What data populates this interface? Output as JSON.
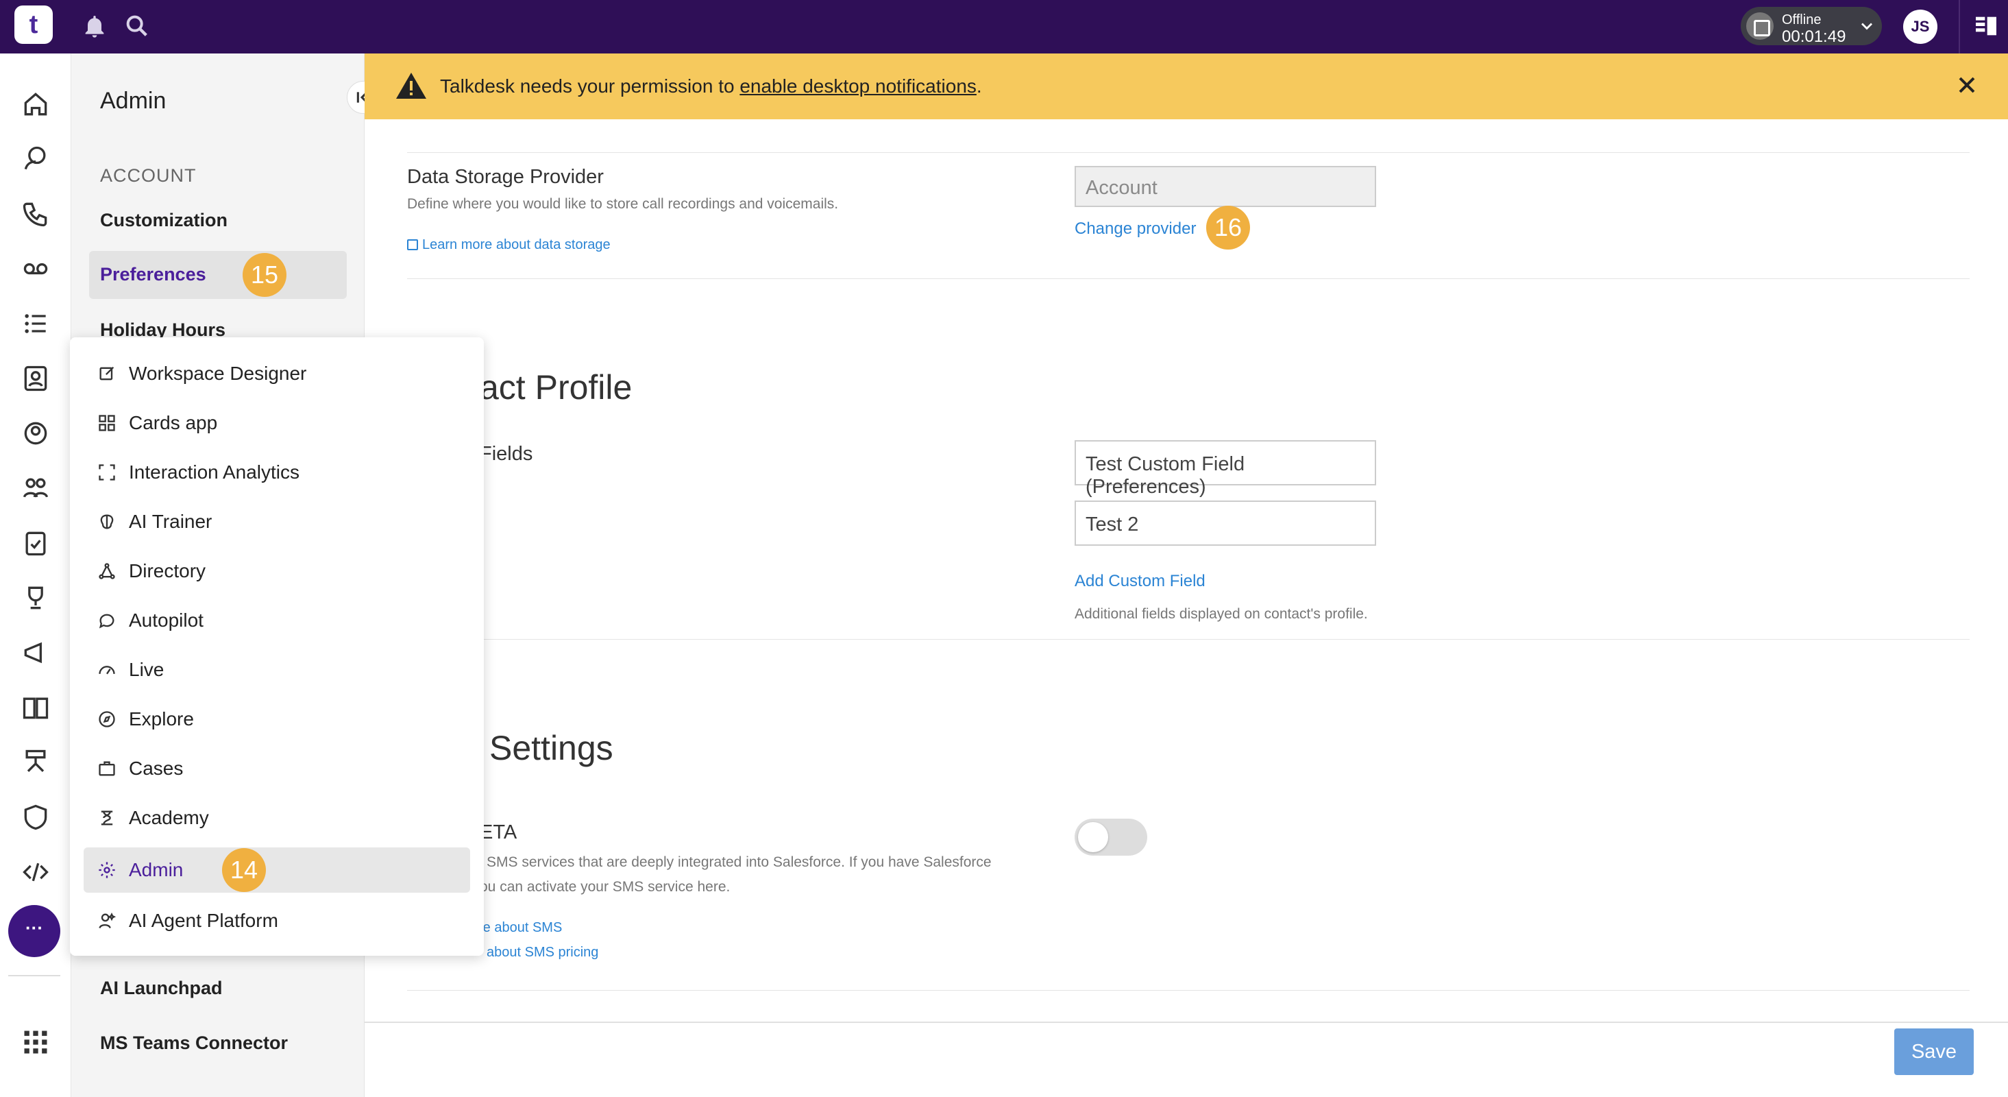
{
  "topbar": {
    "logo_text": "t",
    "status_label": "Offline",
    "status_time": "00:01:49",
    "avatar_initials": "JS"
  },
  "panel": {
    "title": "Admin",
    "section": "ACCOUNT",
    "items": [
      "Customization",
      "Preferences",
      "Holiday Hours"
    ],
    "below_items": [
      "AI Launchpad",
      "MS Teams Connector"
    ]
  },
  "banner": {
    "text_before": "Talkdesk needs your permission to ",
    "link": "enable desktop notifications",
    "text_after": "."
  },
  "data_storage": {
    "label": "Data Storage Provider",
    "description": "Define where you would like to store call recordings and voicemails.",
    "learn_more": "Learn more about data storage",
    "input_value": "Account",
    "change_provider": "Change provider"
  },
  "contact_profile": {
    "title": "act Profile",
    "fields_label": "Fields",
    "field1": "Test Custom Field (Preferences)",
    "field2": "Test 2",
    "add_field": "Add Custom Field",
    "hint": "Additional fields displayed on contact's profile."
  },
  "sms": {
    "title": "Settings",
    "label": "ETA",
    "desc1": "SMS services that are deeply integrated into Salesforce. If you have Salesforce",
    "desc2": "ou can activate your SMS service here.",
    "link1": "re about SMS",
    "link2": "about SMS pricing"
  },
  "footer": {
    "save": "Save"
  },
  "menu": {
    "items": [
      {
        "label": "Workspace Designer",
        "icon": "edit-square-icon"
      },
      {
        "label": "Cards app",
        "icon": "grid-icon"
      },
      {
        "label": "Interaction Analytics",
        "icon": "scan-icon"
      },
      {
        "label": "AI Trainer",
        "icon": "brain-icon"
      },
      {
        "label": "Directory",
        "icon": "network-icon"
      },
      {
        "label": "Autopilot",
        "icon": "chat-bot-icon"
      },
      {
        "label": "Live",
        "icon": "gauge-icon"
      },
      {
        "label": "Explore",
        "icon": "compass-icon"
      },
      {
        "label": "Cases",
        "icon": "briefcase-icon"
      },
      {
        "label": "Academy",
        "icon": "academy-icon"
      },
      {
        "label": "Admin",
        "icon": "gear-icon"
      },
      {
        "label": "AI Agent Platform",
        "icon": "agent-icon"
      }
    ]
  },
  "badges": {
    "preferences": "15",
    "admin": "14",
    "change_provider": "16"
  },
  "colors": {
    "topbar": "#2f0f57",
    "banner": "#f6c95d",
    "accent": "#4b1f9b",
    "link": "#2b84d4",
    "badge": "#f0b040"
  }
}
